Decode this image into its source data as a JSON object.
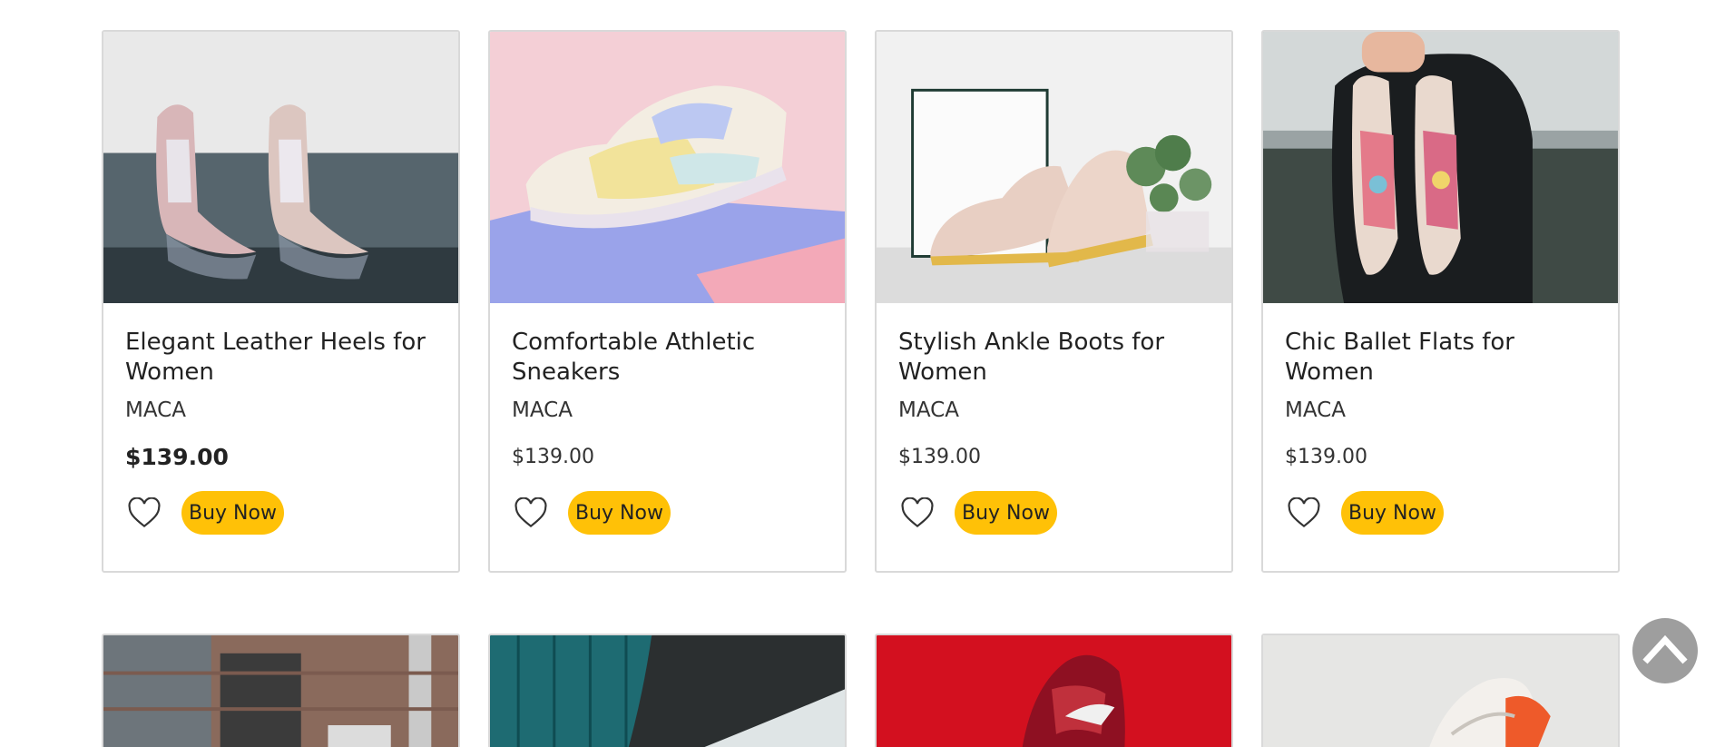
{
  "products": [
    {
      "title": "Elegant Leather Heels for Women",
      "brand": "MACA",
      "price": "$139.00",
      "buy_label": "Buy Now",
      "image": "glitter-heels-photo"
    },
    {
      "title": "Comfortable Athletic Sneakers",
      "brand": "MACA",
      "price": "$139.00",
      "buy_label": "Buy Now",
      "image": "pastel-sneakers-photo"
    },
    {
      "title": "Stylish Ankle Boots for Women",
      "brand": "MACA",
      "price": "$139.00",
      "buy_label": "Buy Now",
      "image": "pink-oxford-shoes-photo"
    },
    {
      "title": "Chic Ballet Flats for Women",
      "brand": "MACA",
      "price": "$139.00",
      "buy_label": "Buy Now",
      "image": "printed-slip-ons-photo"
    }
  ],
  "next_row_images": [
    "brick-building-photo",
    "teal-building-legs-photo",
    "red-nike-shoe-photo",
    "white-orange-sneaker-photo"
  ],
  "icons": {
    "favorite": "heart-outline-icon",
    "scroll_top": "chevron-up-icon"
  },
  "colors": {
    "buy_button": "#ffc107",
    "scroll_top_bg": "#9e9e9e",
    "card_border": "#d9d9d9"
  }
}
